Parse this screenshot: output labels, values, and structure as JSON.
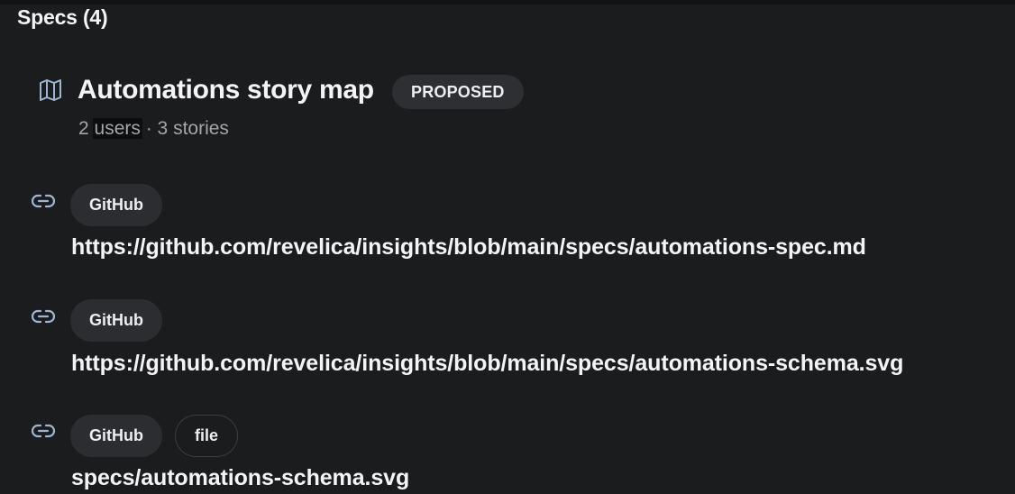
{
  "section": {
    "title": "Specs (4)"
  },
  "story_map": {
    "icon": "map-icon",
    "title": "Automations story map",
    "status": "PROPOSED",
    "meta_count_users": "2",
    "meta_users_word": "users",
    "meta_rest": "· 3 stories"
  },
  "links": [
    {
      "icon": "link-icon",
      "tags": [
        "GitHub"
      ],
      "url": "https://github.com/revelica/insights/blob/main/specs/automations-spec.md"
    },
    {
      "icon": "link-icon",
      "tags": [
        "GitHub"
      ],
      "url": "https://github.com/revelica/insights/blob/main/specs/automations-schema.svg"
    },
    {
      "icon": "link-icon",
      "tags": [
        "GitHub",
        "file"
      ],
      "url": "specs/automations-schema.svg"
    }
  ],
  "colors": {
    "background": "#1b1c1e",
    "icon_accent": "#9fb6d3",
    "pill_bg": "#2b2d30"
  }
}
